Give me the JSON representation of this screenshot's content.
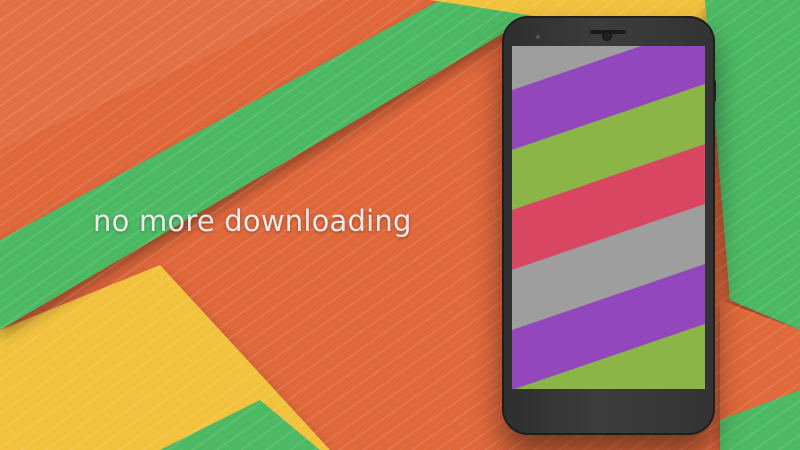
{
  "tagline": "no more downloading",
  "colors": {
    "orange": "#e0673a",
    "green": "#4cb963",
    "yellow": "#f2c23d",
    "screen_purple": "#9347bd",
    "screen_green": "#8bb547",
    "screen_red": "#d94661",
    "screen_gray": "#9e9e9e",
    "phone_body": "#333333"
  }
}
